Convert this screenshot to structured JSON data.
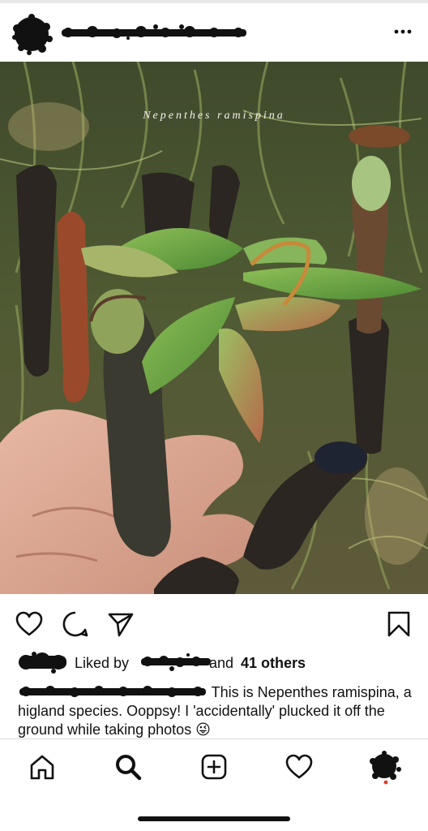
{
  "post": {
    "more_icon": "ellipsis-horizontal-icon",
    "photo_overlay_text": "Nepenthes ramispina"
  },
  "actions": {
    "like_icon": "heart-outline-icon",
    "comment_icon": "comment-bubble-icon",
    "share_icon": "paper-plane-icon",
    "save_icon": "bookmark-outline-icon"
  },
  "likes": {
    "prefix": "Liked by",
    "suffix_and": "and",
    "others": "41 others"
  },
  "caption": {
    "text": " This is Nepenthes ramispina, a higland species. Ooppsy! I 'accidentally' plucked it off the ground while taking photos",
    "emoji": "😜"
  },
  "tabbar": {
    "items": [
      {
        "name": "home",
        "icon": "home-icon"
      },
      {
        "name": "search",
        "icon": "search-icon"
      },
      {
        "name": "new-post",
        "icon": "plus-square-icon"
      },
      {
        "name": "activity",
        "icon": "heart-outline-icon"
      },
      {
        "name": "profile",
        "icon": "profile-avatar-icon"
      }
    ]
  },
  "colors": {
    "text": "#111111",
    "divider": "#dbdbdb",
    "redaction": "#111111"
  }
}
